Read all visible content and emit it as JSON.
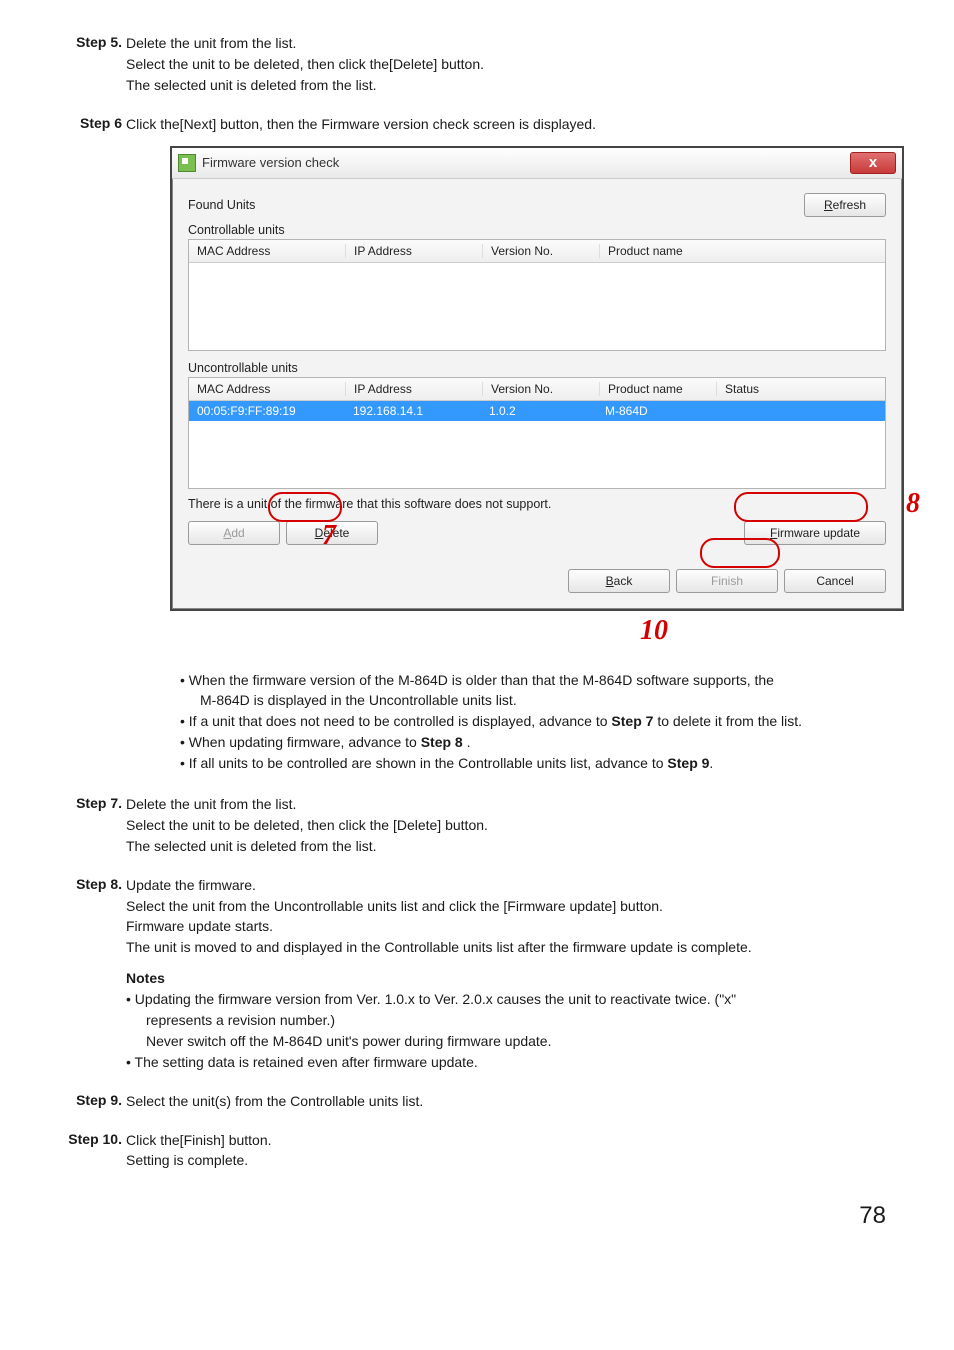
{
  "step5": {
    "label": "Step 5.",
    "line1": "Delete the unit from the list.",
    "line2": "Select the unit to be deleted, then click the[Delete] button.",
    "line3": "The selected unit is deleted from the list."
  },
  "step6": {
    "label": "Step 6",
    "line1": "Click the[Next] button, then the Firmware version check screen is displayed."
  },
  "dialog": {
    "title": "Firmware version check",
    "found_units": "Found Units",
    "refresh": "Refresh",
    "controllable_units": "Controllable units",
    "uncontrollable_units": "Uncontrollable units",
    "headers": {
      "mac": "MAC Address",
      "ip": "IP Address",
      "ver": "Version No.",
      "prod": "Product name",
      "status": "Status"
    },
    "row1": {
      "mac": "00:05:F9:FF:89:19",
      "ip": "192.168.14.1",
      "ver": "1.0.2",
      "prod": "M-864D"
    },
    "support_msg": "There is a unit of the firmware that this software does not support.",
    "add": "Add",
    "delete": "Delete",
    "firmware_update": "Firmware update",
    "back": "Back",
    "finish": "Finish",
    "cancel": "Cancel"
  },
  "annot": {
    "n7": "7",
    "n8": "8",
    "n10": "10"
  },
  "bullets": {
    "b1a": "When the firmware version of the M-864D is older than that the M-864D software supports, the",
    "b1b": "M-864D is displayed in the Uncontrollable units list.",
    "b2a": "If a unit that does not need to be controlled is displayed, advance to ",
    "b2b": "Step 7",
    "b2c": " to delete it from the list.",
    "b3a": "When updating firmware, advance to ",
    "b3b": "Step 8",
    "b3c": " .",
    "b4a": "If all units to be controlled are shown in the Controllable units list, advance to ",
    "b4b": "Step 9",
    "b4c": "."
  },
  "step7": {
    "label": "Step 7.",
    "line1": "Delete the unit from the list.",
    "line2": "Select the unit to be deleted, then click the [Delete] button.",
    "line3": "The selected unit is deleted from the list."
  },
  "step8": {
    "label": "Step 8.",
    "line1": "Update the firmware.",
    "line2": "Select the unit from the Uncontrollable units list and click the [Firmware update] button.",
    "line3": "Firmware update starts.",
    "line4": "The unit is moved to and displayed in the Controllable units list after the firmware update is complete.",
    "notes_h": "Notes",
    "n1a": "Updating the firmware version from Ver. 1.0.x to Ver. 2.0.x causes the unit to reactivate twice. (\"x\"",
    "n1b": "represents a revision number.)",
    "n1c": "Never switch off the M-864D unit's power during firmware update.",
    "n2": "The setting data is retained even after firmware update."
  },
  "step9": {
    "label": "Step 9.",
    "line1": "Select the unit(s) from the Controllable units list."
  },
  "step10": {
    "label": "Step 10.",
    "line1": "Click the[Finish] button.",
    "line2": "Setting is complete."
  },
  "page_number": "78"
}
